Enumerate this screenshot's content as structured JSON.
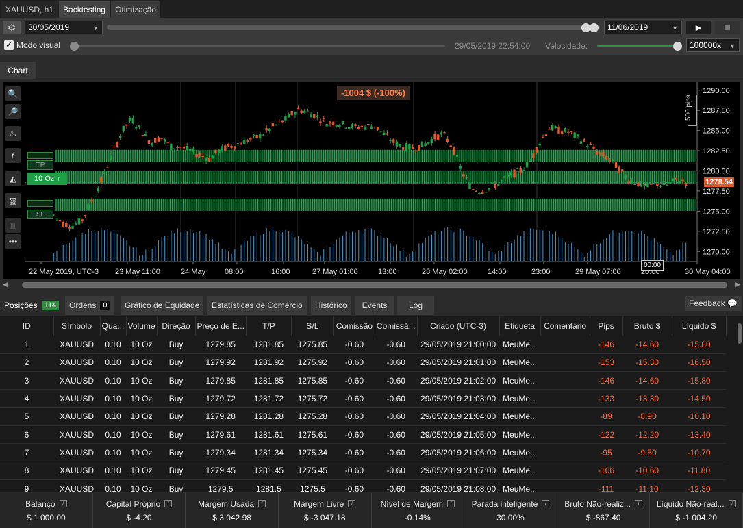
{
  "top_tabs": {
    "symbol": "XAUUSD, h1",
    "backtesting": "Backtesting",
    "optimization": "Otimização"
  },
  "controls": {
    "start_date": "30/05/2019",
    "end_date": "11/06/2019",
    "visual_mode_label": "Modo visual",
    "current_time": "29/05/2019 22:54:00",
    "speed_label": "Velocidade:",
    "speed_value": "100000x"
  },
  "chart_tab": "Chart",
  "chart": {
    "pnl_label": "-1004 $ (-100%)",
    "scale_label": "500 pips",
    "current_price": "1278.54",
    "tp_label": "TP",
    "sl_label": "SL",
    "volume_label": "10 Oz",
    "time_cursor": "00:00",
    "colors": {
      "bull": "#1f9e48",
      "bear": "#e2572a",
      "volume": "#3e9bd6",
      "price_tag": "#e2572a"
    }
  },
  "chart_data": {
    "type": "candlestick",
    "y_ticks": [
      "1290.00",
      "1287.50",
      "1285.00",
      "1282.50",
      "1280.00",
      "1277.50",
      "1275.00",
      "1272.50",
      "1270.00"
    ],
    "ylim": [
      1268.75,
      1291.0
    ],
    "x_ticks": [
      "22 May 2019, UTC-3",
      "23 May 11:00",
      "24 May",
      "08:00",
      "16:00",
      "27 May 01:00",
      "13:00",
      "28 May 02:00",
      "14:00",
      "23:00",
      "29 May 07:00",
      "20:00",
      "30 May 04:00"
    ],
    "tp_level": 1281.85,
    "entry_level": 1279.2,
    "sl_level": 1275.8
  },
  "bottom_tabs": {
    "positions": "Posições",
    "positions_count": "114",
    "orders": "Ordens",
    "orders_count": "0",
    "equity": "Gráfico de Equidade",
    "stats": "Estatísticas de Comércio",
    "history": "Histórico",
    "events": "Events",
    "log": "Log",
    "feedback": "Feedback"
  },
  "table": {
    "headers": [
      "ID",
      "Símbolo",
      "Qua...",
      "Volume",
      "Direção",
      "Preço de E...",
      "T/P",
      "S/L",
      "Comissão",
      "Comissã...",
      "Criado (UTC-3)",
      "Etiqueta",
      "Comentário",
      "Pips",
      "Bruto $",
      "Líquido $"
    ],
    "rows": [
      [
        "1",
        "XAUUSD",
        "0.10",
        "10 Oz",
        "Buy",
        "1279.85",
        "1281.85",
        "1275.85",
        "-0.60",
        "-0.60",
        "29/05/2019 21:00:00",
        "MeuMe...",
        "",
        "-146",
        "-14.60",
        "-15.80"
      ],
      [
        "2",
        "XAUUSD",
        "0.10",
        "10 Oz",
        "Buy",
        "1279.92",
        "1281.92",
        "1275.92",
        "-0.60",
        "-0.60",
        "29/05/2019 21:01:00",
        "MeuMe...",
        "",
        "-153",
        "-15.30",
        "-16.50"
      ],
      [
        "3",
        "XAUUSD",
        "0.10",
        "10 Oz",
        "Buy",
        "1279.85",
        "1281.85",
        "1275.85",
        "-0.60",
        "-0.60",
        "29/05/2019 21:02:00",
        "MeuMe...",
        "",
        "-146",
        "-14.60",
        "-15.80"
      ],
      [
        "4",
        "XAUUSD",
        "0.10",
        "10 Oz",
        "Buy",
        "1279.72",
        "1281.72",
        "1275.72",
        "-0.60",
        "-0.60",
        "29/05/2019 21:03:00",
        "MeuMe...",
        "",
        "-133",
        "-13.30",
        "-14.50"
      ],
      [
        "5",
        "XAUUSD",
        "0.10",
        "10 Oz",
        "Buy",
        "1279.28",
        "1281.28",
        "1275.28",
        "-0.60",
        "-0.60",
        "29/05/2019 21:04:00",
        "MeuMe...",
        "",
        "-89",
        "-8.90",
        "-10.10"
      ],
      [
        "6",
        "XAUUSD",
        "0.10",
        "10 Oz",
        "Buy",
        "1279.61",
        "1281.61",
        "1275.61",
        "-0.60",
        "-0.60",
        "29/05/2019 21:05:00",
        "MeuMe...",
        "",
        "-122",
        "-12.20",
        "-13.40"
      ],
      [
        "7",
        "XAUUSD",
        "0.10",
        "10 Oz",
        "Buy",
        "1279.34",
        "1281.34",
        "1275.34",
        "-0.60",
        "-0.60",
        "29/05/2019 21:06:00",
        "MeuMe...",
        "",
        "-95",
        "-9.50",
        "-10.70"
      ],
      [
        "8",
        "XAUUSD",
        "0.10",
        "10 Oz",
        "Buy",
        "1279.45",
        "1281.45",
        "1275.45",
        "-0.60",
        "-0.60",
        "29/05/2019 21:07:00",
        "MeuMe...",
        "",
        "-106",
        "-10.60",
        "-11.80"
      ],
      [
        "9",
        "XAUUSD",
        "0.10",
        "10 Oz",
        "Buy",
        "1279.5",
        "1281.5",
        "1275.5",
        "-0.60",
        "-0.60",
        "29/05/2019 21:08:00",
        "MeuMe...",
        "",
        "-111",
        "-11.10",
        "-12.30"
      ]
    ]
  },
  "footer": [
    {
      "label": "Balanço",
      "value": "$ 1 000.00"
    },
    {
      "label": "Capital Próprio",
      "value": "$ -4.20"
    },
    {
      "label": "Margem Usada",
      "value": "$ 3 042.98"
    },
    {
      "label": "Margem Livre",
      "value": "$ -3 047.18"
    },
    {
      "label": "Nível de Margem",
      "value": "-0.14%"
    },
    {
      "label": "Parada inteligente",
      "value": "30.00%"
    },
    {
      "label": "Bruto Não-realiz...",
      "value": "$ -867.40"
    },
    {
      "label": "Líquido Não-real...",
      "value": "$ -1 004.20"
    }
  ]
}
